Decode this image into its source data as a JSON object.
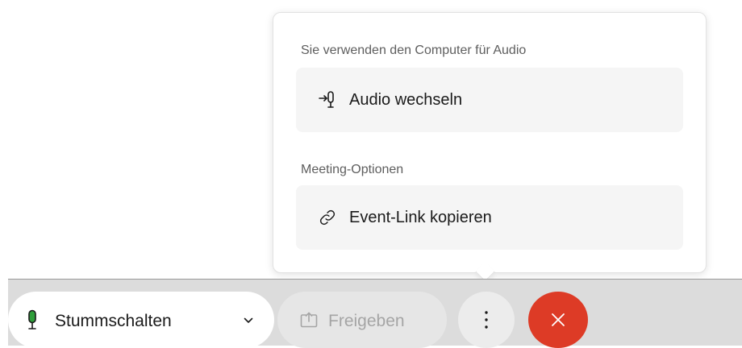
{
  "popover": {
    "audio_section_label": "Sie verwenden den Computer für Audio",
    "switch_audio_label": "Audio wechseln",
    "meeting_section_label": "Meeting-Optionen",
    "copy_link_label": "Event-Link kopieren"
  },
  "toolbar": {
    "mute_label": "Stummschalten",
    "share_label": "Freigeben",
    "more_icon": "more-vertical-icon",
    "end_icon": "close-icon"
  },
  "colors": {
    "end_button": "#dd3b26",
    "mic_active": "#2e9e3a",
    "toolbar_bg": "#dcdcdc"
  }
}
